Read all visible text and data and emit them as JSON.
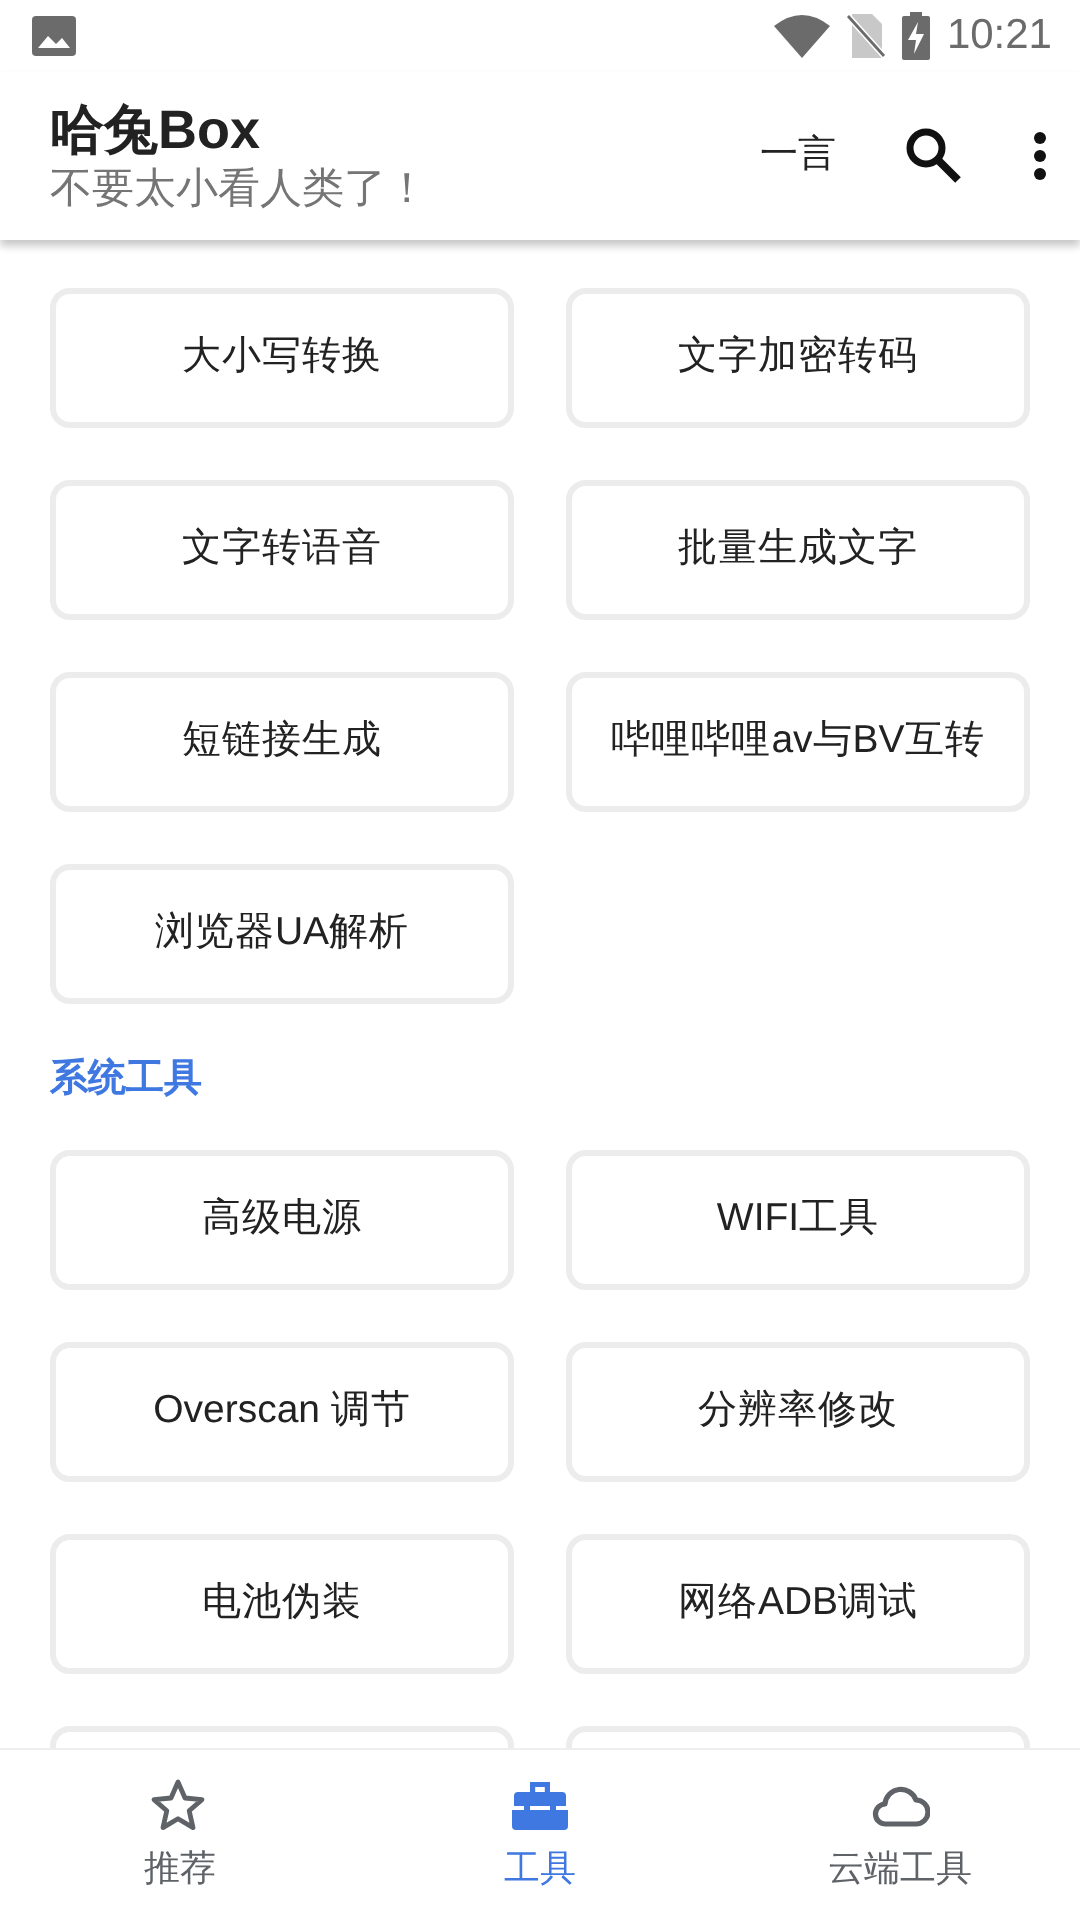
{
  "status_bar": {
    "time": "10:21"
  },
  "app_bar": {
    "title": "哈兔Box",
    "subtitle": "不要太小看人类了！",
    "action_text": "一言"
  },
  "sections": [
    {
      "items": [
        {
          "kind": "tool",
          "label": "大小写转换"
        },
        {
          "kind": "tool",
          "label": "文字加密转码"
        },
        {
          "kind": "tool",
          "label": "文字转语音"
        },
        {
          "kind": "tool",
          "label": "批量生成文字"
        },
        {
          "kind": "tool",
          "label": "短链接生成"
        },
        {
          "kind": "tool",
          "label": "哔哩哔哩av与BV互转"
        },
        {
          "kind": "tool",
          "label": "浏览器UA解析"
        }
      ]
    },
    {
      "title": "系统工具",
      "items": [
        {
          "kind": "tool",
          "label": "高级电源"
        },
        {
          "kind": "tool",
          "label": "WIFI工具"
        },
        {
          "kind": "tool",
          "label": "Overscan 调节"
        },
        {
          "kind": "tool",
          "label": "分辨率修改"
        },
        {
          "kind": "tool",
          "label": "电池伪装"
        },
        {
          "kind": "tool",
          "label": "网络ADB调试"
        },
        {
          "kind": "cut"
        },
        {
          "kind": "cut"
        }
      ]
    }
  ],
  "bottom_nav": [
    {
      "label": "推荐",
      "selected": false
    },
    {
      "label": "工具",
      "selected": true
    },
    {
      "label": "云端工具",
      "selected": false
    }
  ]
}
